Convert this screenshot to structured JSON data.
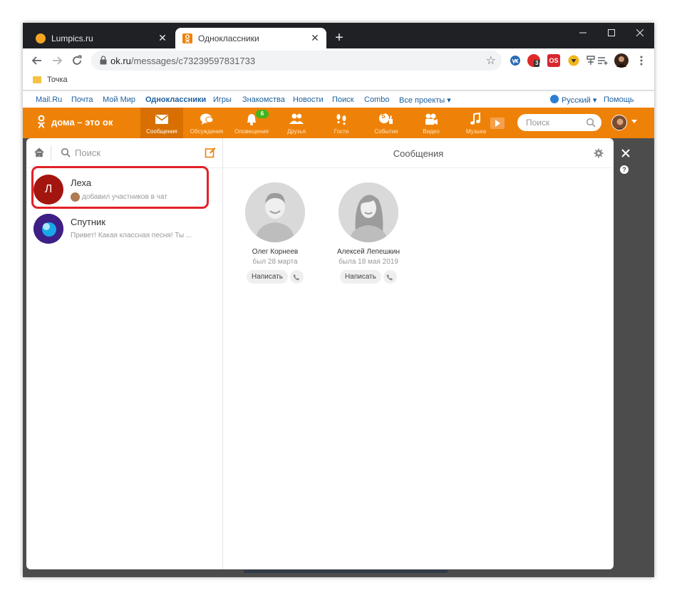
{
  "browser": {
    "tabs": [
      {
        "title": "Lumpics.ru",
        "active": false
      },
      {
        "title": "Одноклассники",
        "active": true
      }
    ],
    "close_glyph": "✕",
    "new_tab_glyph": "+",
    "url_host": "ok.ru",
    "url_path": "/messages/c73239597831733",
    "extensions": [
      {
        "name": "vk-extension-icon",
        "color": "#2a6cb3",
        "label": ""
      },
      {
        "name": "opera-badge-icon",
        "color": "#e02a2a",
        "label": "3"
      },
      {
        "name": "os-icon",
        "color": "#d8262e",
        "label": "OS"
      },
      {
        "name": "shield-extension-icon",
        "color": "#f2b51b",
        "label": ""
      }
    ],
    "bookmarks": [
      {
        "label": "Точка"
      }
    ]
  },
  "portal": {
    "links": [
      "Mail.Ru",
      "Почта",
      "Мой Мир",
      "Одноклассники",
      "Игры",
      "Знакомства",
      "Новости",
      "Поиск",
      "Combo",
      "Все проекты ▾"
    ],
    "language": "Русский ▾",
    "help": "Помощь"
  },
  "ok": {
    "logo_text": "дома – это ок",
    "accent_color": "#ee8208",
    "nav": [
      {
        "label": "Сообщения",
        "icon": "envelope-icon",
        "active": true
      },
      {
        "label": "Обсуждения",
        "icon": "discussions-icon",
        "active": false
      },
      {
        "label": "Оповещения",
        "icon": "bell-icon",
        "active": false,
        "badge": "6"
      },
      {
        "label": "Друзья",
        "icon": "friends-icon",
        "active": false
      },
      {
        "label": "Гости",
        "icon": "footprints-icon",
        "active": false
      },
      {
        "label": "События",
        "icon": "events-icon",
        "active": false,
        "badge": "5"
      },
      {
        "label": "Видео",
        "icon": "video-icon",
        "active": false
      },
      {
        "label": "Музыка",
        "icon": "music-icon",
        "active": false
      }
    ],
    "search_placeholder": "Поиск"
  },
  "messages": {
    "search_placeholder": "Поиск",
    "title": "Сообщения",
    "chats": [
      {
        "initial": "Л",
        "name": "Леха",
        "preview": "добавил участников в чат",
        "avatar_color": "#a3150f"
      },
      {
        "initial": "",
        "name": "Спутник",
        "preview": "Привет! Какая классная песня! Ты ...",
        "avatar_color": "#4a2a8c"
      }
    ],
    "contacts": [
      {
        "name": "Олег Корнеев",
        "status": "был 28 марта",
        "write": "Написать"
      },
      {
        "name": "Алексей Лепешкин",
        "status": "была 18 мая 2019",
        "write": "Написать"
      }
    ]
  }
}
